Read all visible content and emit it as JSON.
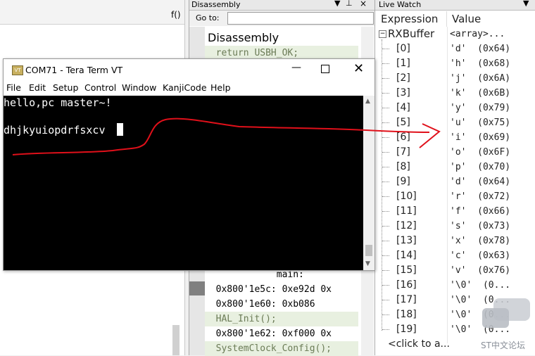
{
  "left_panel": {
    "fn_icon": "f()"
  },
  "disassembly": {
    "title": "Disassembly",
    "goto_label": "Go to:",
    "header": "Disassembly",
    "lines": [
      {
        "text": "  return USBH_OK;",
        "kind": "src"
      },
      {
        "text": "             main:",
        "kind": "asm"
      },
      {
        "text": "  0x800'1e5c: 0xe92d 0x",
        "kind": "asm"
      },
      {
        "text": "  0x800'1e60: 0xb086",
        "kind": "asm"
      },
      {
        "text": "  HAL_Init();",
        "kind": "src"
      },
      {
        "text": "  0x800'1e62: 0xf000 0x",
        "kind": "asm"
      },
      {
        "text": "  SystemClock_Config();",
        "kind": "src"
      }
    ]
  },
  "watch": {
    "title": "Live Watch",
    "col_expression": "Expression",
    "col_value": "Value",
    "root": {
      "name": "RXBuffer",
      "value": "<array>..."
    },
    "rows": [
      {
        "idx": "[0]",
        "val": "'d'  (0x64)"
      },
      {
        "idx": "[1]",
        "val": "'h'  (0x68)"
      },
      {
        "idx": "[2]",
        "val": "'j'  (0x6A)"
      },
      {
        "idx": "[3]",
        "val": "'k'  (0x6B)"
      },
      {
        "idx": "[4]",
        "val": "'y'  (0x79)"
      },
      {
        "idx": "[5]",
        "val": "'u'  (0x75)"
      },
      {
        "idx": "[6]",
        "val": "'i'  (0x69)"
      },
      {
        "idx": "[7]",
        "val": "'o'  (0x6F)"
      },
      {
        "idx": "[8]",
        "val": "'p'  (0x70)"
      },
      {
        "idx": "[9]",
        "val": "'d'  (0x64)"
      },
      {
        "idx": "[10]",
        "val": "'r'  (0x72)"
      },
      {
        "idx": "[11]",
        "val": "'f'  (0x66)"
      },
      {
        "idx": "[12]",
        "val": "'s'  (0x73)"
      },
      {
        "idx": "[13]",
        "val": "'x'  (0x78)"
      },
      {
        "idx": "[14]",
        "val": "'c'  (0x63)"
      },
      {
        "idx": "[15]",
        "val": "'v'  (0x76)"
      },
      {
        "idx": "[16]",
        "val": "'\\0'  (0..."
      },
      {
        "idx": "[17]",
        "val": "'\\0'  (0..."
      },
      {
        "idx": "[18]",
        "val": "'\\0'  (0..."
      },
      {
        "idx": "[19]",
        "val": "'\\0'  (0..."
      }
    ],
    "click_to_add": "<click to a...",
    "watermark": "ST中文论坛"
  },
  "teraterm": {
    "title": "COM71 - Tera Term VT",
    "menu": [
      "File",
      "Edit",
      "Setup",
      "Control",
      "Window",
      "KanjiCode",
      "Help"
    ],
    "lines": [
      "hello,pc master~!",
      "dhjkyuiopdrfsxcv"
    ]
  },
  "colors": {
    "annotation": "#e0101a",
    "terminal_bg": "#000000"
  }
}
